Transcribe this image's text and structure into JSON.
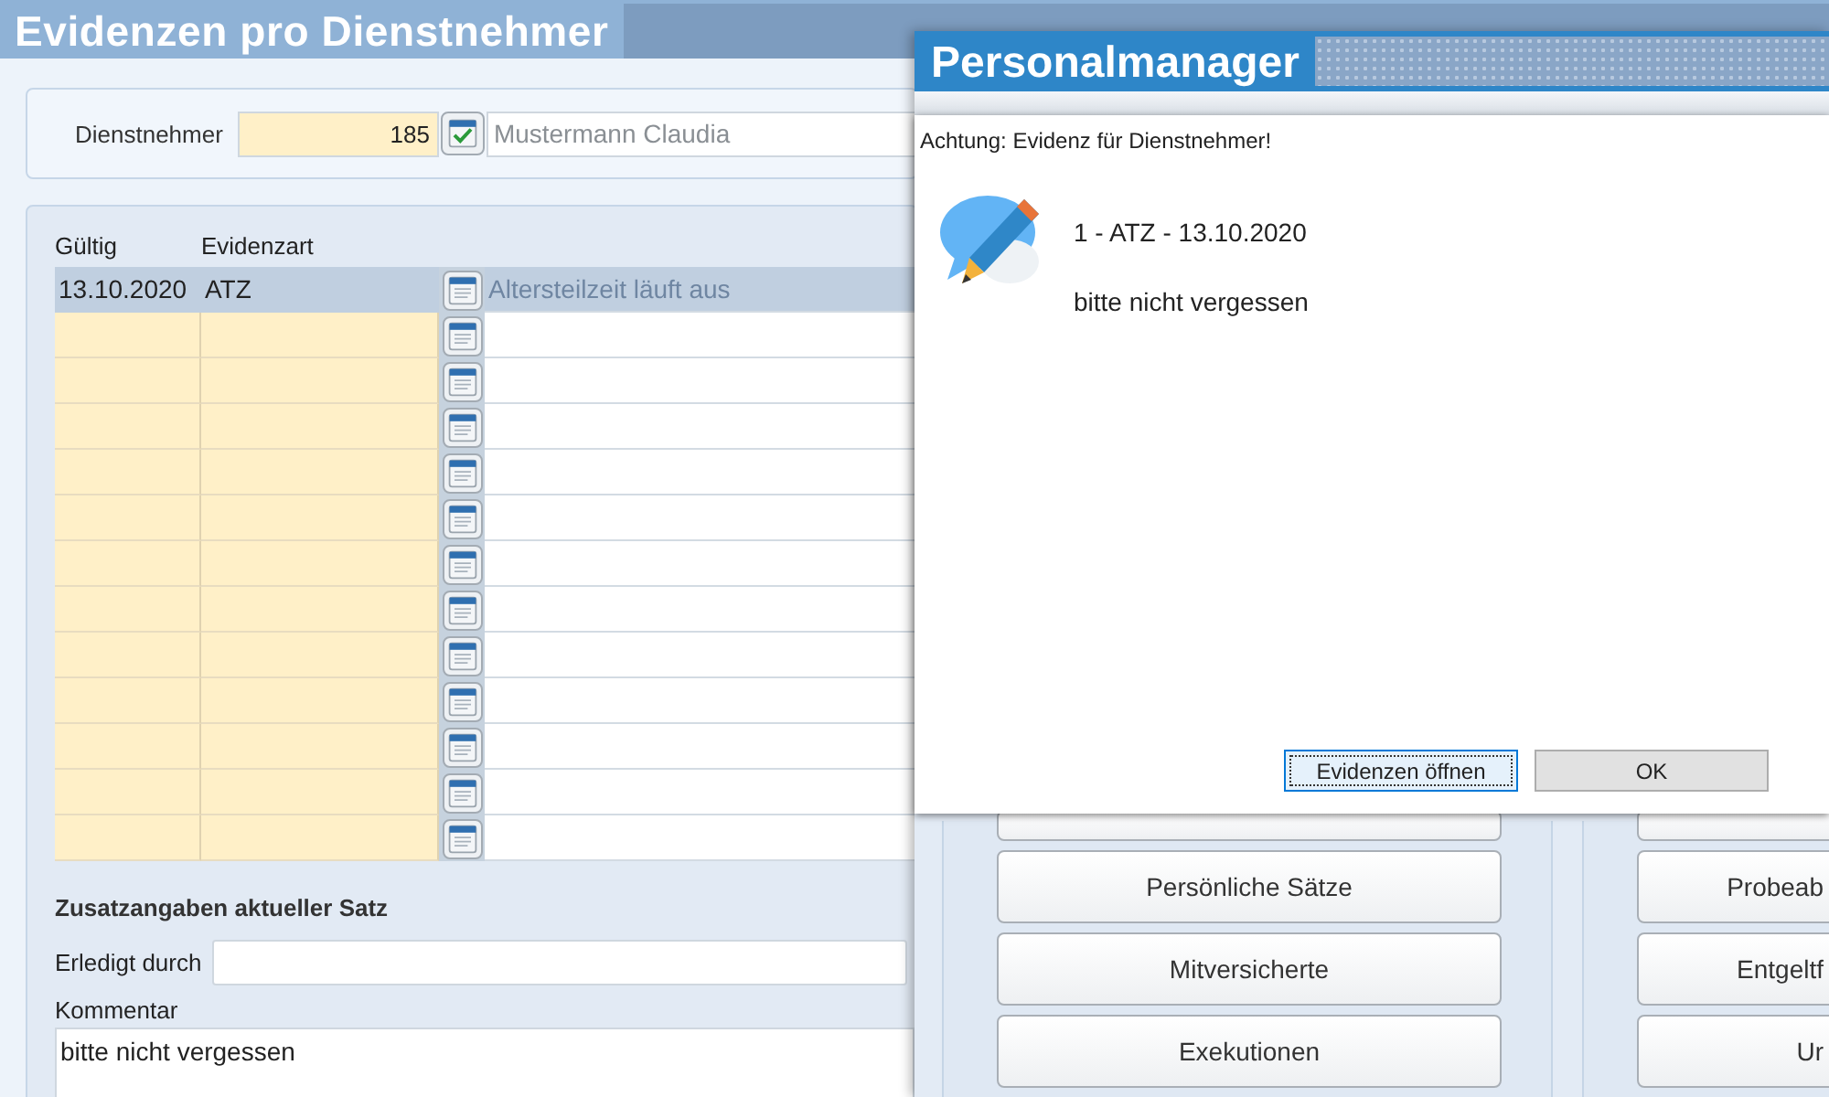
{
  "main_window": {
    "title": "Evidenzen pro Dienstnehmer",
    "employee": {
      "label": "Dienstnehmer",
      "number": "185",
      "name": "Mustermann Claudia"
    },
    "table": {
      "columns": [
        "Gültig",
        "Evidenzart"
      ],
      "rows": [
        {
          "valid": "13.10.2020",
          "type": "ATZ",
          "description": "Altersteilzeit läuft aus",
          "selected": true
        },
        {
          "selected": false
        },
        {
          "selected": false
        },
        {
          "selected": false
        },
        {
          "selected": false
        },
        {
          "selected": false
        },
        {
          "selected": false
        },
        {
          "selected": false
        },
        {
          "selected": false
        },
        {
          "selected": false
        },
        {
          "selected": false
        },
        {
          "selected": false
        },
        {
          "selected": false
        }
      ]
    },
    "details": {
      "heading": "Zusatzangaben aktueller Satz",
      "done_by": {
        "label": "Erledigt durch"
      },
      "comment": {
        "label": "Kommentar",
        "value": "bitte nicht vergessen"
      }
    }
  },
  "back_window": {
    "title": "Personalmanager",
    "left_buttons": [
      {
        "label": "Persönliche Sätze"
      },
      {
        "label": "Mitversicherte"
      },
      {
        "label": "Exekutionen"
      }
    ],
    "right_buttons": [
      {
        "label": "Probeab"
      },
      {
        "label": "Entgeltf"
      },
      {
        "label": "Ur"
      }
    ]
  },
  "dialog": {
    "title": "Achtung: Evidenz für Dienstnehmer!",
    "headline": "1 - ATZ - 13.10.2020",
    "message": "bitte nicht vergessen",
    "buttons": [
      {
        "label": "Evidenzen öffnen",
        "focused": true
      },
      {
        "label": "OK",
        "focused": false
      }
    ]
  }
}
